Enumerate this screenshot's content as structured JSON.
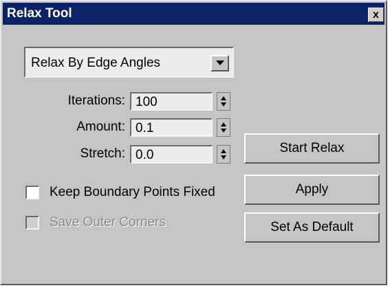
{
  "window": {
    "title": "Relax Tool",
    "close_label": "x"
  },
  "relax": {
    "method": "Relax By Edge Angles",
    "params": [
      {
        "label": "Iterations:",
        "value": "100"
      },
      {
        "label": "Amount:",
        "value": "0.1"
      },
      {
        "label": "Stretch:",
        "value": "0.0"
      }
    ],
    "checkboxes": [
      {
        "label": "Keep Boundary Points Fixed",
        "checked": false,
        "enabled": true
      },
      {
        "label": "Save Outer Corners",
        "checked": false,
        "enabled": false
      }
    ],
    "buttons": {
      "start": "Start Relax",
      "apply": "Apply",
      "set_default": "Set As Default"
    }
  }
}
